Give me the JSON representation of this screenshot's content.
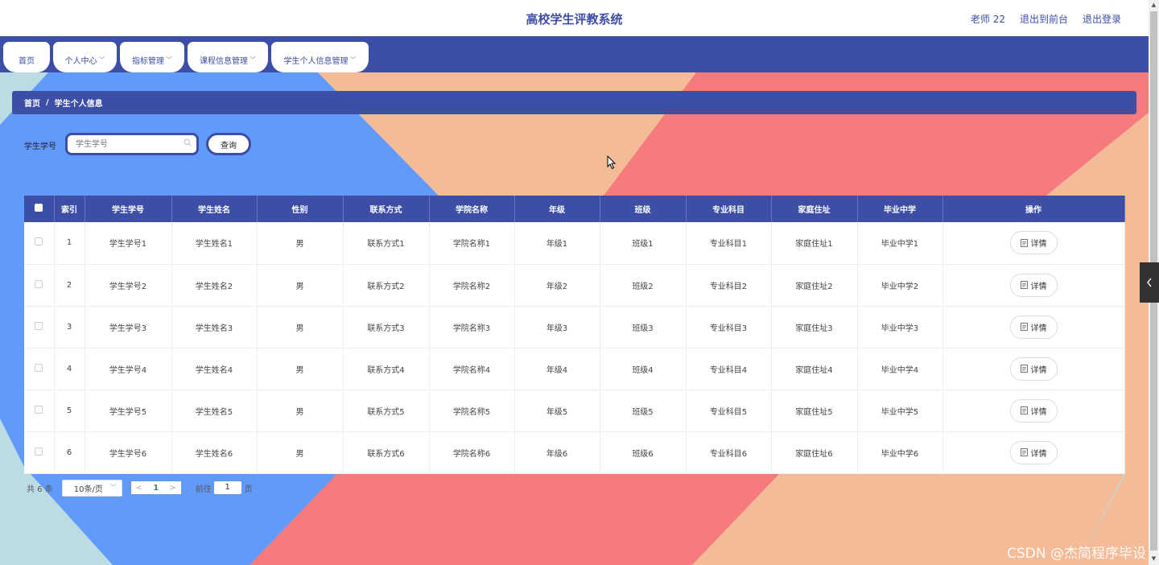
{
  "header": {
    "title": "高校学生评教系统",
    "links": [
      "老师 22",
      "退出到前台",
      "退出登录"
    ]
  },
  "nav": {
    "tabs": [
      {
        "label": "首页",
        "has_dropdown": false
      },
      {
        "label": "个人中心",
        "has_dropdown": true
      },
      {
        "label": "指标管理",
        "has_dropdown": true
      },
      {
        "label": "课程信息管理",
        "has_dropdown": true
      },
      {
        "label": "学生个人信息管理",
        "has_dropdown": true
      }
    ]
  },
  "breadcrumb": {
    "home": "首页",
    "separator": "/",
    "current": "学生个人信息"
  },
  "search": {
    "label": "学生学号",
    "placeholder": "学生学号",
    "button": "查询"
  },
  "table": {
    "headers": [
      "",
      "索引",
      "学生学号",
      "学生姓名",
      "性别",
      "联系方式",
      "学院名称",
      "年级",
      "班级",
      "专业科目",
      "家庭住址",
      "毕业中学",
      "操作"
    ],
    "action_label": "详情",
    "rows": [
      [
        "1",
        "学生学号1",
        "学生姓名1",
        "男",
        "联系方式1",
        "学院名称1",
        "年级1",
        "班级1",
        "专业科目1",
        "家庭住址1",
        "毕业中学1"
      ],
      [
        "2",
        "学生学号2",
        "学生姓名2",
        "男",
        "联系方式2",
        "学院名称2",
        "年级2",
        "班级2",
        "专业科目2",
        "家庭住址2",
        "毕业中学2"
      ],
      [
        "3",
        "学生学号3",
        "学生姓名3",
        "男",
        "联系方式3",
        "学院名称3",
        "年级3",
        "班级3",
        "专业科目3",
        "家庭住址3",
        "毕业中学3"
      ],
      [
        "4",
        "学生学号4",
        "学生姓名4",
        "男",
        "联系方式4",
        "学院名称4",
        "年级4",
        "班级4",
        "专业科目4",
        "家庭住址4",
        "毕业中学4"
      ],
      [
        "5",
        "学生学号5",
        "学生姓名5",
        "男",
        "联系方式5",
        "学院名称5",
        "年级5",
        "班级5",
        "专业科目5",
        "家庭住址5",
        "毕业中学5"
      ],
      [
        "6",
        "学生学号6",
        "学生姓名6",
        "男",
        "联系方式6",
        "学院名称6",
        "年级6",
        "班级6",
        "专业科目6",
        "家庭住址6",
        "毕业中学6"
      ]
    ]
  },
  "pagination": {
    "total": "共 6 条",
    "page_size": "10条/页",
    "prev": "<",
    "current_page": "1",
    "next": ">",
    "goto_label": "前往",
    "goto_value": "1",
    "page_suffix": "页"
  },
  "watermark": "CSDN @杰简程序毕设",
  "colors": {
    "primary": "#3c4ea6",
    "bg_light_blue": "#bcdce4",
    "bg_blue": "#619afa",
    "bg_peach": "#f4bb98",
    "bg_coral": "#f77b7d"
  }
}
